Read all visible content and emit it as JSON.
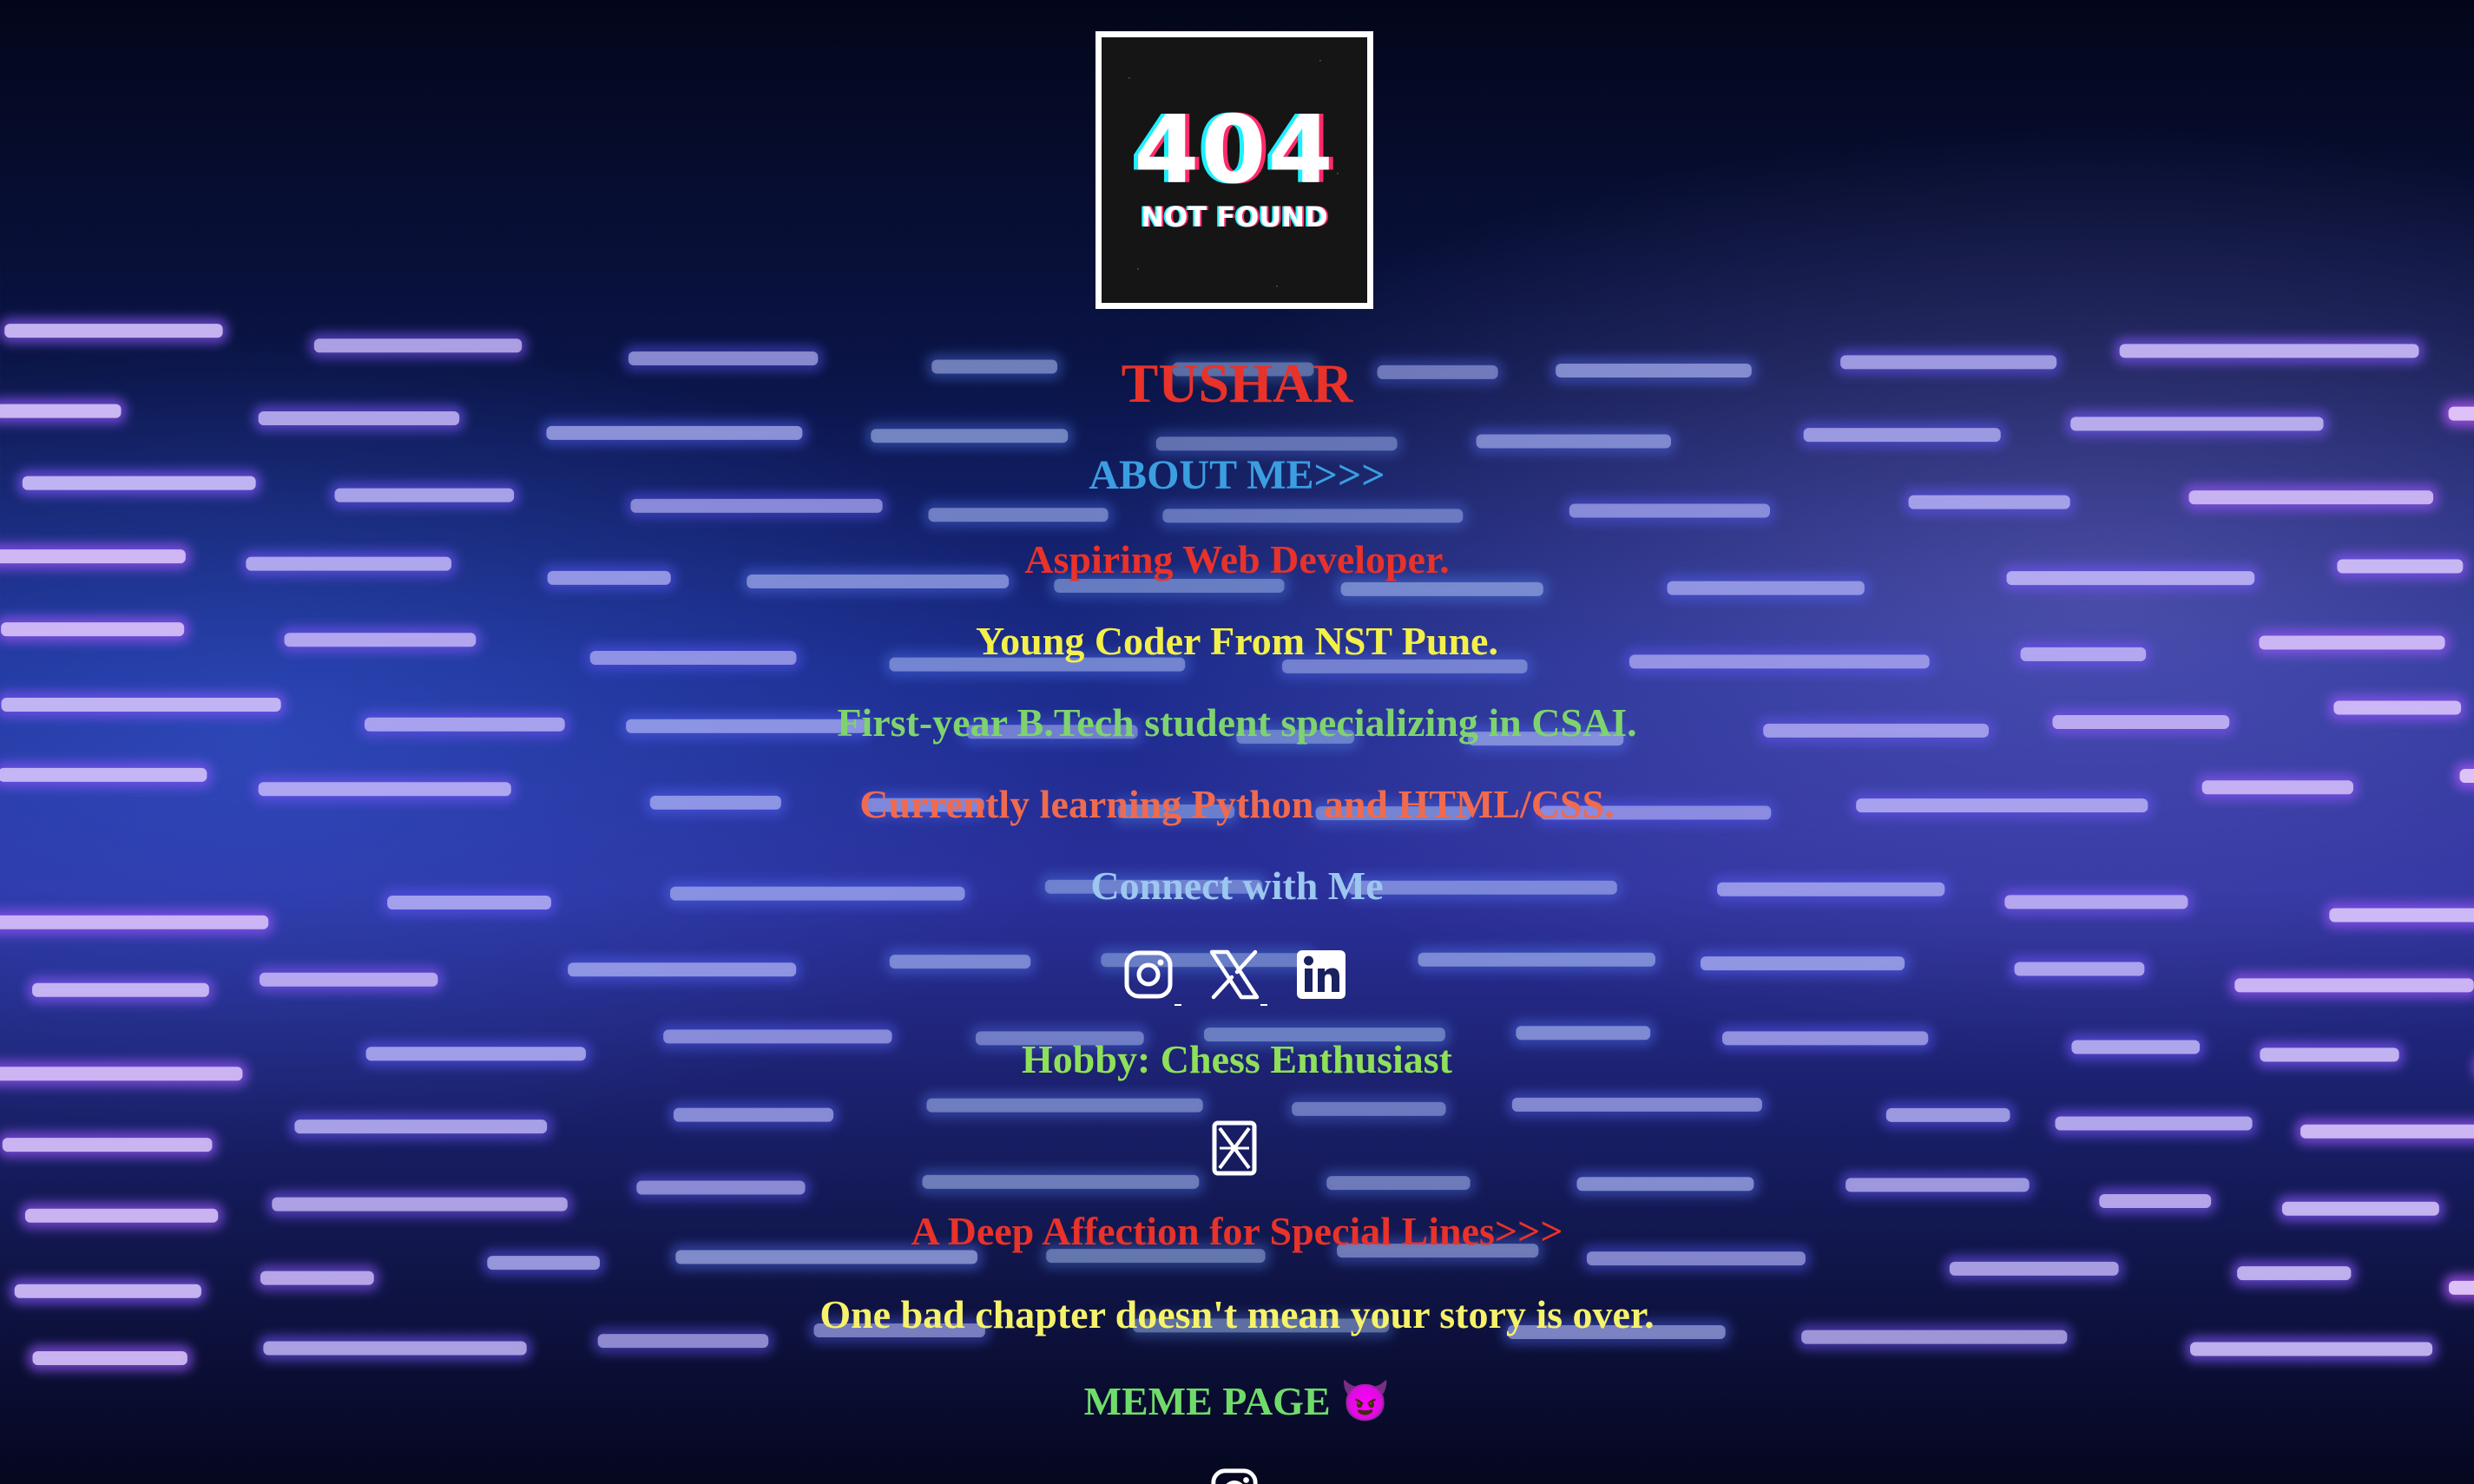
{
  "profile": {
    "logo_title": "404",
    "logo_subtitle": "NOT FOUND",
    "name": "TUSHAR"
  },
  "about": {
    "heading": "ABOUT ME>>>",
    "lines": [
      "Aspiring Web Developer.",
      "Young Coder From NST Pune.",
      "First-year B.Tech student specializing in CSAI.",
      "Currently learning Python and HTML/CSS."
    ]
  },
  "connect": {
    "heading": "Connect with Me",
    "icons": [
      "instagram-icon",
      "x-twitter-icon",
      "linkedin-icon"
    ]
  },
  "hobby": {
    "text": "Hobby: Chess Enthusiast",
    "icon": "chess-piece-icon"
  },
  "lines_section": {
    "heading": "A Deep Affection for Special Lines>>>",
    "quote": "One bad chapter doesn't mean your story is over."
  },
  "meme": {
    "label": "MEME PAGE",
    "emoji": "😈",
    "icon": "instagram-icon"
  },
  "colors": {
    "name": "#e8322a",
    "about_heading": "#3b9ee0",
    "line1": "#e8322a",
    "line2": "#f3f04a",
    "line3": "#7fd36e",
    "line4": "#ef6a4e",
    "connect": "#9cc7ef",
    "hobby": "#8ee05a",
    "quote": "#f6f36a",
    "meme": "#6fdc6a"
  }
}
